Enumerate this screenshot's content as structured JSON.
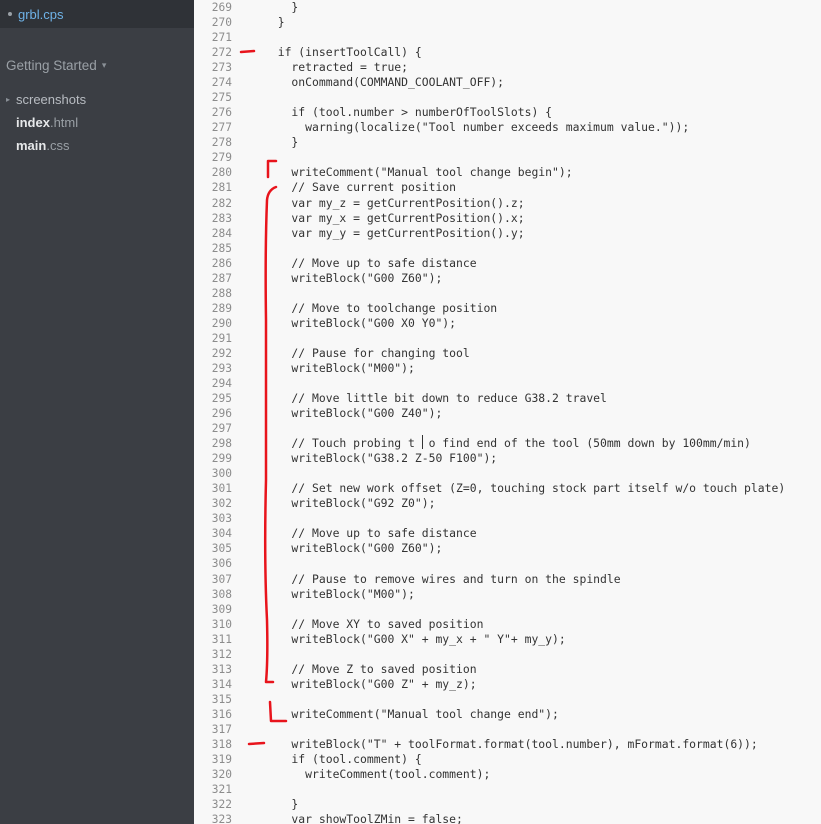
{
  "sidebar": {
    "open_file": "grbl.cps",
    "project": "Getting Started",
    "items": [
      {
        "label": "screenshots",
        "kind": "folder"
      },
      {
        "name": "index",
        "ext": ".html",
        "kind": "file"
      },
      {
        "name": "main",
        "ext": ".css",
        "kind": "file"
      }
    ]
  },
  "editor": {
    "lines": [
      {
        "n": "269",
        "text": "    }"
      },
      {
        "n": "270",
        "text": "  }"
      },
      {
        "n": "271",
        "text": ""
      },
      {
        "n": "272",
        "text": "  if (insertToolCall) {"
      },
      {
        "n": "273",
        "text": "    retracted = true;"
      },
      {
        "n": "274",
        "text": "    onCommand(COMMAND_COOLANT_OFF);"
      },
      {
        "n": "275",
        "text": ""
      },
      {
        "n": "276",
        "text": "    if (tool.number > numberOfToolSlots) {"
      },
      {
        "n": "277",
        "text": "      warning(localize(\"Tool number exceeds maximum value.\"));"
      },
      {
        "n": "278",
        "text": "    }"
      },
      {
        "n": "279",
        "text": ""
      },
      {
        "n": "280",
        "text": "    writeComment(\"Manual tool change begin\");"
      },
      {
        "n": "281",
        "text": "    // Save current position"
      },
      {
        "n": "282",
        "text": "    var my_z = getCurrentPosition().z;"
      },
      {
        "n": "283",
        "text": "    var my_x = getCurrentPosition().x;"
      },
      {
        "n": "284",
        "text": "    var my_y = getCurrentPosition().y;"
      },
      {
        "n": "285",
        "text": ""
      },
      {
        "n": "286",
        "text": "    // Move up to safe distance"
      },
      {
        "n": "287",
        "text": "    writeBlock(\"G00 Z60\");"
      },
      {
        "n": "288",
        "text": ""
      },
      {
        "n": "289",
        "text": "    // Move to toolchange position"
      },
      {
        "n": "290",
        "text": "    writeBlock(\"G00 X0 Y0\");"
      },
      {
        "n": "291",
        "text": ""
      },
      {
        "n": "292",
        "text": "    // Pause for changing tool"
      },
      {
        "n": "293",
        "text": "    writeBlock(\"M00\");"
      },
      {
        "n": "294",
        "text": ""
      },
      {
        "n": "295",
        "text": "    // Move little bit down to reduce G38.2 travel"
      },
      {
        "n": "296",
        "text": "    writeBlock(\"G00 Z40\");"
      },
      {
        "n": "297",
        "text": ""
      },
      {
        "n": "298",
        "text": "    // Touch probing t  o find end of the tool (50mm down by 100mm/min)"
      },
      {
        "n": "299",
        "text": "    writeBlock(\"G38.2 Z-50 F100\");"
      },
      {
        "n": "300",
        "text": ""
      },
      {
        "n": "301",
        "text": "    // Set new work offset (Z=0, touching stock part itself w/o touch plate)"
      },
      {
        "n": "302",
        "text": "    writeBlock(\"G92 Z0\");"
      },
      {
        "n": "303",
        "text": ""
      },
      {
        "n": "304",
        "text": "    // Move up to safe distance"
      },
      {
        "n": "305",
        "text": "    writeBlock(\"G00 Z60\");"
      },
      {
        "n": "306",
        "text": ""
      },
      {
        "n": "307",
        "text": "    // Pause to remove wires and turn on the spindle"
      },
      {
        "n": "308",
        "text": "    writeBlock(\"M00\");"
      },
      {
        "n": "309",
        "text": ""
      },
      {
        "n": "310",
        "text": "    // Move XY to saved position"
      },
      {
        "n": "311",
        "text": "    writeBlock(\"G00 X\" + my_x + \" Y\"+ my_y);"
      },
      {
        "n": "312",
        "text": ""
      },
      {
        "n": "313",
        "text": "    // Move Z to saved position"
      },
      {
        "n": "314",
        "text": "    writeBlock(\"G00 Z\" + my_z);"
      },
      {
        "n": "315",
        "text": ""
      },
      {
        "n": "316",
        "text": "    writeComment(\"Manual tool change end\");"
      },
      {
        "n": "317",
        "text": ""
      },
      {
        "n": "318",
        "text": "    writeBlock(\"T\" + toolFormat.format(tool.number), mFormat.format(6));"
      },
      {
        "n": "319",
        "text": "    if (tool.comment) {"
      },
      {
        "n": "320",
        "text": "      writeComment(tool.comment);"
      },
      {
        "n": "321",
        "text": ""
      },
      {
        "n": "322",
        "text": "    }"
      },
      {
        "n": "323",
        "text": "    var showToolZMin = false;"
      }
    ]
  },
  "colors": {
    "sidebar_bg": "#3b3e44",
    "editor_bg": "#f8f8f8",
    "annotation": "#e8141c",
    "open_file_text": "#6fb3e8"
  }
}
